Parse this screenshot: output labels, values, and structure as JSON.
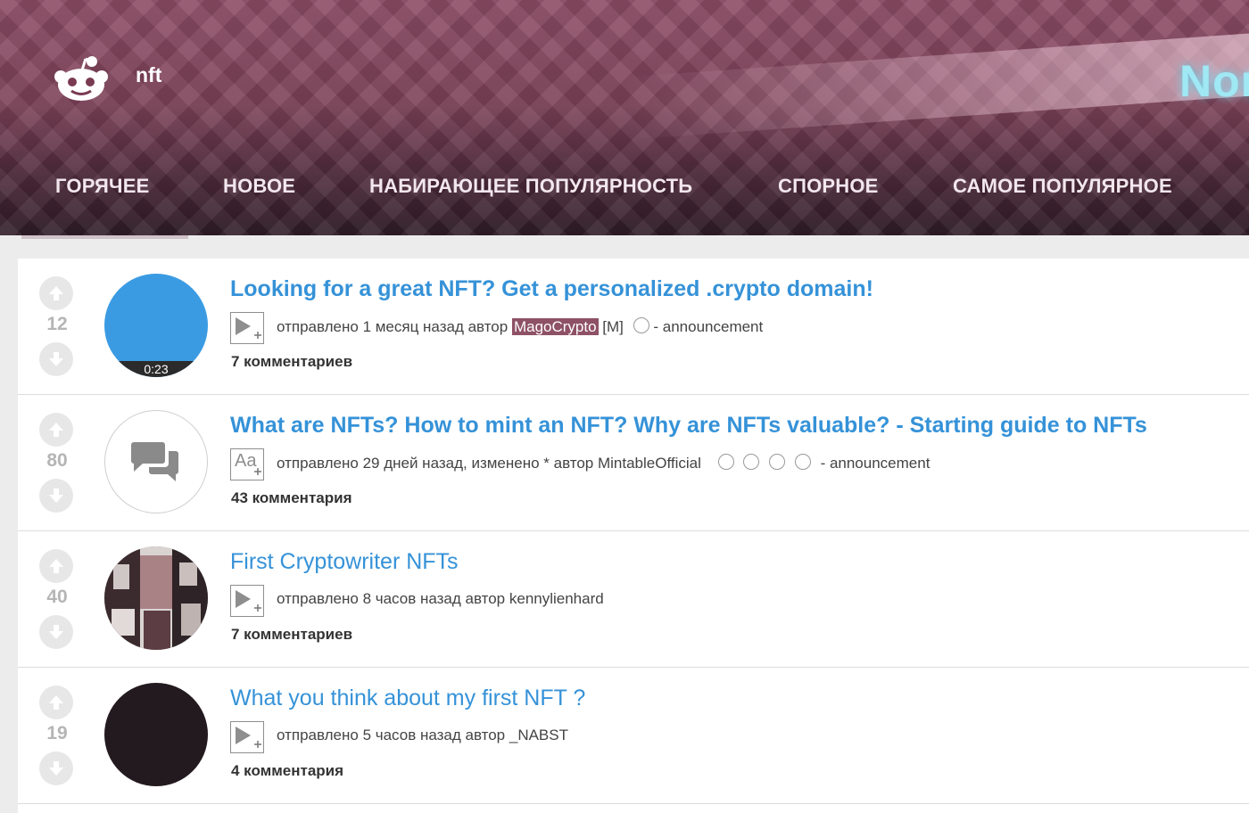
{
  "header": {
    "subreddit": "nft",
    "banner_text": "Nor",
    "tabs": [
      {
        "label": "ГОРЯЧЕЕ",
        "active": true
      },
      {
        "label": "НОВОЕ"
      },
      {
        "label": "НАБИРАЮЩЕЕ ПОПУЛЯРНОСТЬ"
      },
      {
        "label": "СПОРНОЕ"
      },
      {
        "label": "САМОЕ ПОПУЛЯРНОЕ"
      }
    ]
  },
  "posts": [
    {
      "score": "12",
      "title": "Looking for a great NFT? Get a personalized .crypto domain!",
      "meta_prefix": "отправлено 1 месяц назад автор",
      "author": "MagoCrypto",
      "author_suffix": "[M]",
      "flair": "- announcement",
      "comments": "7 комментариев",
      "thumb_type": "video",
      "thumb_color": "#3a9be3",
      "duration": "0:23",
      "expando_icon": "play-icon"
    },
    {
      "score": "80",
      "title": "What are NFTs? How to mint an NFT? Why are NFTs valuable? - Starting guide to NFTs",
      "meta_prefix": "отправлено 29 дней назад, изменено * автор",
      "author": "MintableOfficial",
      "flair": "- announcement",
      "comments": "43 комментария",
      "thumb_type": "self",
      "expando_icon": "text-icon",
      "expando_text": "Aa"
    },
    {
      "score": "40",
      "title": "First Cryptowriter NFTs",
      "meta_prefix": "отправлено 8 часов назад автор",
      "author": "kennylienhard",
      "comments": "7 комментариев",
      "thumb_type": "image",
      "expando_icon": "play-icon"
    },
    {
      "score": "19",
      "title": "What you think about my first NFT ?",
      "meta_prefix": "отправлено 5 часов назад автор",
      "author": "_NABST",
      "comments": "4 комментария",
      "thumb_type": "dark",
      "thumb_color": "#231a1f",
      "expando_icon": "play-icon"
    }
  ],
  "colors": {
    "link": "#3592d8",
    "score": "#b5b5b5"
  }
}
